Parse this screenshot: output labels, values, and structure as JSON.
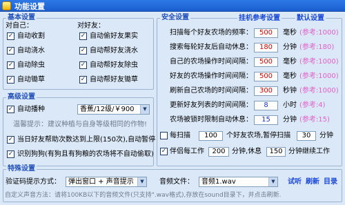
{
  "window": {
    "title": "功能设置"
  },
  "basic": {
    "title": "基本设置",
    "self_label": "对自己：",
    "friend_label": "对好友：",
    "self_items": [
      {
        "label": "自动收割",
        "checked": true
      },
      {
        "label": "自动浇水",
        "checked": true
      },
      {
        "label": "自动除虫",
        "checked": true
      },
      {
        "label": "自动锄草",
        "checked": true
      }
    ],
    "friend_items": [
      {
        "label": "自动偷好友果实",
        "checked": true
      },
      {
        "label": "自动帮好友浇水",
        "checked": true
      },
      {
        "label": "自动帮好友除虫",
        "checked": true
      },
      {
        "label": "自动帮好友锄草",
        "checked": true
      }
    ]
  },
  "advanced": {
    "title": "高级设置",
    "auto_sow_label": "自动播种",
    "auto_sow_checked": true,
    "seed_select": "香蕉/12级/￥900",
    "tip": "温馨提示：建议种植与自身等级相同的作物!",
    "help_limit_label": "当日好友帮助次数达到上限(150次),自动暂停",
    "help_limit_checked": true,
    "identify_dog_label": "识别狗狗(有狗且有狗粮的农场将不自动偷取)",
    "identify_dog_checked": true
  },
  "safety": {
    "title": "安全设置",
    "link_ref": "挂机参考设置",
    "link_default": "默认设置",
    "rows": [
      {
        "label": "扫描每个好友农场的频率：",
        "value": "500",
        "unit": "毫秒",
        "hint": "(参考:1000)",
        "color": "red"
      },
      {
        "label": "搜索每轮好友后自动休息：",
        "value": "180",
        "unit": "分钟",
        "hint": "(参考:180)",
        "color": "red"
      },
      {
        "label": "自己的农场操作时间间隔：",
        "value": "500",
        "unit": "毫秒",
        "hint": "(参考:1000)",
        "color": "red"
      },
      {
        "label": "好友的农场操作时间间隔：",
        "value": "500",
        "unit": "毫秒",
        "hint": "(参考:1000)",
        "color": "red"
      },
      {
        "label": "刷新自己农场的时间间隔：",
        "value": "300",
        "unit": "秒钟",
        "hint": "(参考:1000)",
        "color": "red"
      },
      {
        "label": "更新好友列表的时间间隔：",
        "value": "8",
        "unit": "小时",
        "hint": "(参考:4)",
        "color": "blue"
      },
      {
        "label": "农场被锁时限制自动休息：",
        "value": "15",
        "unit": "分钟",
        "hint": "(参考:15)",
        "color": "blue"
      }
    ],
    "scan_label": "每扫描",
    "scan_value": "100",
    "scan_mid": "个好友农场,暂停扫描",
    "scan_pause": "30",
    "scan_unit": "分钟",
    "scan_checked": false,
    "work_label": "伴侣每工作",
    "work_value": "200",
    "work_mid": "分钟,休息",
    "work_rest": "150",
    "work_unit": "分钟继续工作",
    "work_checked": true
  },
  "special": {
    "title": "特殊设置",
    "captcha_label": "验证码提示方式：",
    "captcha_select": "弹出窗口 + 声音提示",
    "audio_label": "音频文件：",
    "audio_select": "音频1.wav",
    "link_test": "试听",
    "link_refresh": "刷新",
    "link_dir": "目录",
    "footer": "自定义声音方法：请将100KB以下的音频文件(只支持\".wav格式),存放在sound目录下，并点击刷新."
  },
  "colors": {
    "title_blue": "#2250b7",
    "hint_pink": "#e060c8",
    "red": "#d80000"
  }
}
